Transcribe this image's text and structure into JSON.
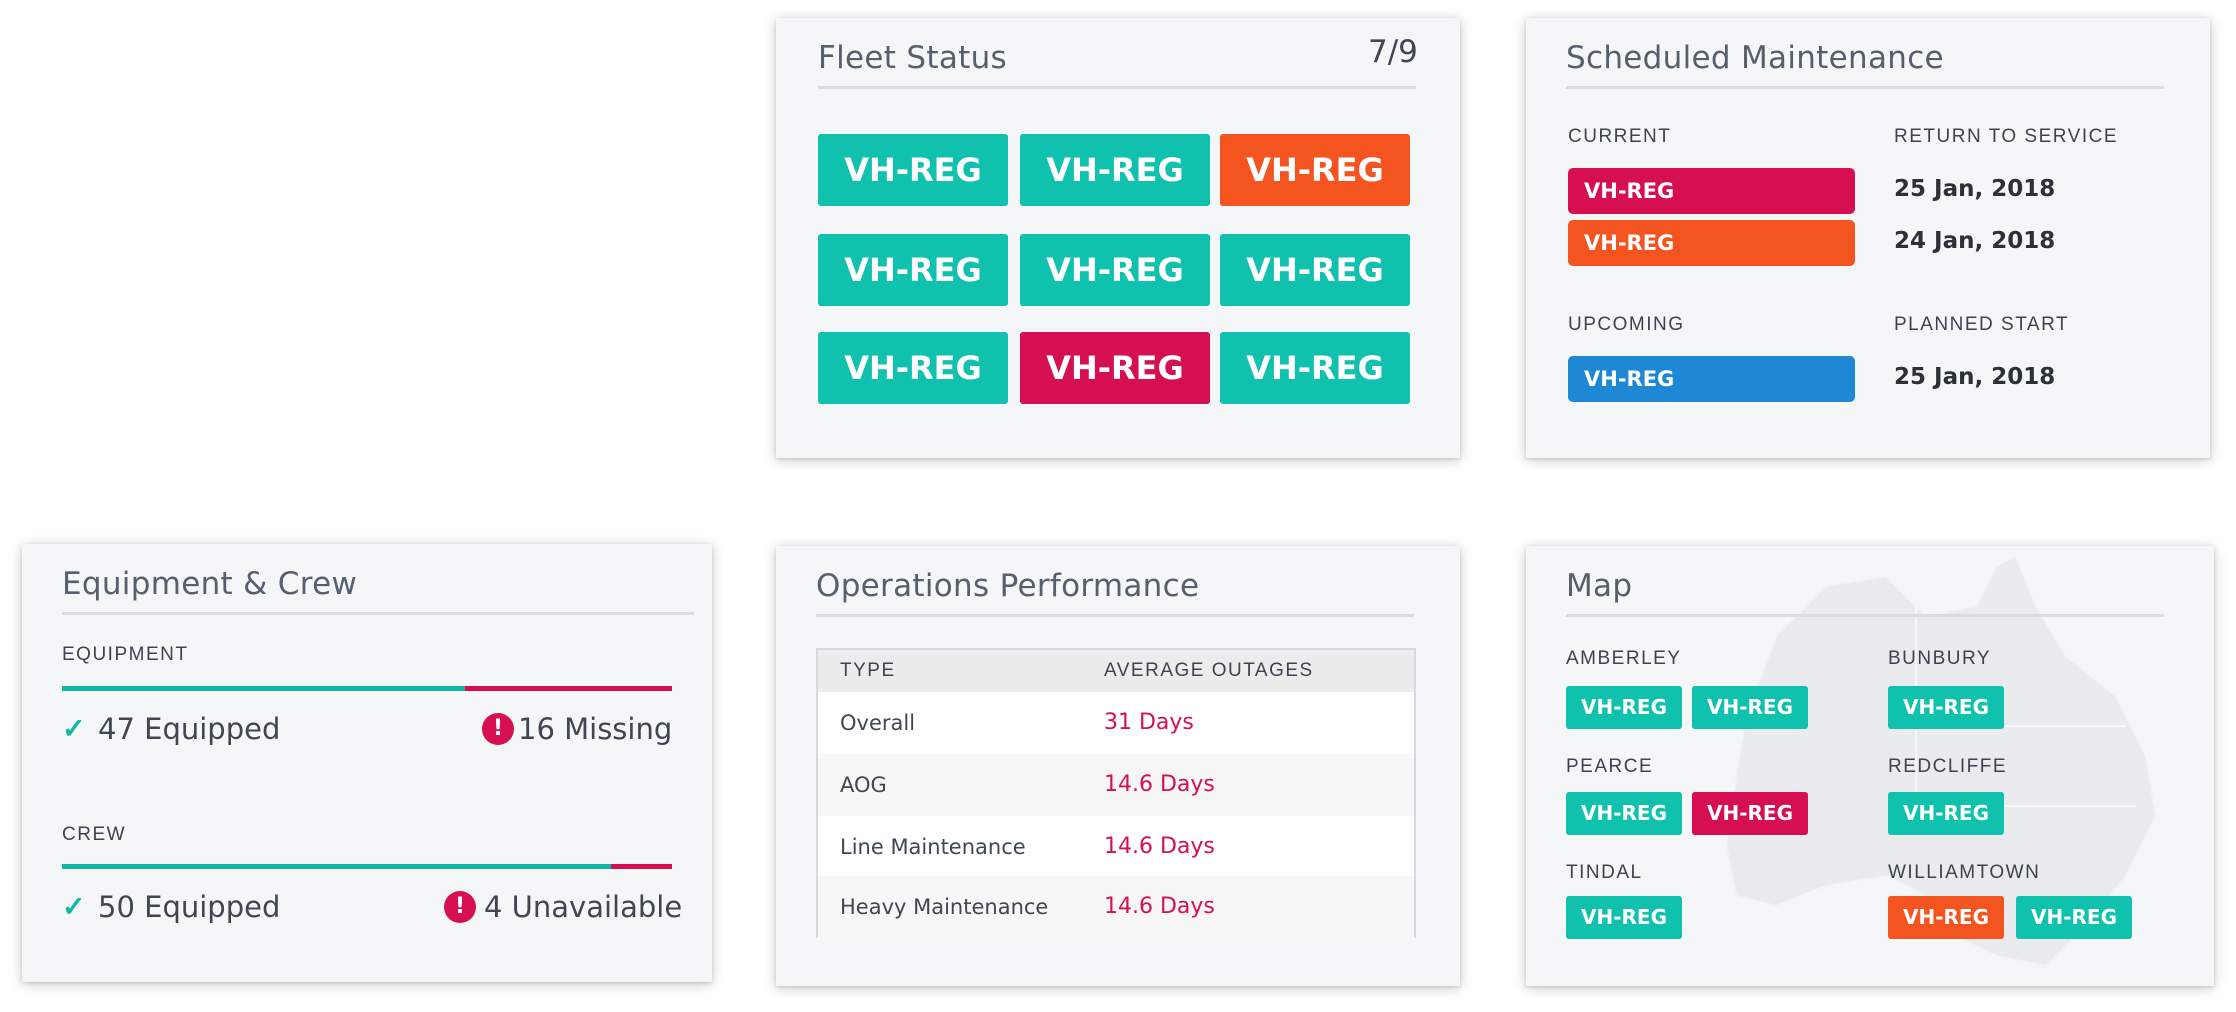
{
  "fleet_status": {
    "title": "Fleet Status",
    "count": "7/9",
    "tiles": [
      {
        "label": "VH-REG",
        "status": "teal"
      },
      {
        "label": "VH-REG",
        "status": "teal"
      },
      {
        "label": "VH-REG",
        "status": "orange"
      },
      {
        "label": "VH-REG",
        "status": "teal"
      },
      {
        "label": "VH-REG",
        "status": "teal"
      },
      {
        "label": "VH-REG",
        "status": "teal"
      },
      {
        "label": "VH-REG",
        "status": "teal"
      },
      {
        "label": "VH-REG",
        "status": "crimson"
      },
      {
        "label": "VH-REG",
        "status": "teal"
      }
    ]
  },
  "scheduled_maintenance": {
    "title": "Scheduled Maintenance",
    "current_label": "CURRENT",
    "return_label": "RETURN TO SERVICE",
    "current": [
      {
        "reg": "VH-REG",
        "date": "25 Jan, 2018",
        "status": "crimson"
      },
      {
        "reg": "VH-REG",
        "date": "24 Jan, 2018",
        "status": "orange"
      }
    ],
    "upcoming_label": "UPCOMING",
    "planned_label": "PLANNED START",
    "upcoming": [
      {
        "reg": "VH-REG",
        "date": "25 Jan, 2018",
        "status": "blue"
      }
    ]
  },
  "equipment_crew": {
    "title": "Equipment & Crew",
    "equipment": {
      "label": "EQUIPMENT",
      "equipped_text": "47 Equipped",
      "missing_text": "16 Missing",
      "equipped_fraction": 0.66
    },
    "crew": {
      "label": "CREW",
      "equipped_text": "50 Equipped",
      "unavailable_text": "4 Unavailable",
      "equipped_fraction": 0.9
    }
  },
  "operations_performance": {
    "title": "Operations Performance",
    "columns": [
      "TYPE",
      "AVERAGE OUTAGES"
    ],
    "rows": [
      {
        "type": "Overall",
        "value": "31 Days"
      },
      {
        "type": "AOG",
        "value": "14.6 Days"
      },
      {
        "type": "Line Maintenance",
        "value": "14.6 Days"
      },
      {
        "type": "Heavy Maintenance",
        "value": "14.6 Days"
      }
    ]
  },
  "map": {
    "title": "Map",
    "locations": [
      {
        "name": "AMBERLEY",
        "tiles": [
          {
            "label": "VH-REG",
            "status": "teal"
          },
          {
            "label": "VH-REG",
            "status": "teal"
          }
        ]
      },
      {
        "name": "BUNBURY",
        "tiles": [
          {
            "label": "VH-REG",
            "status": "teal"
          }
        ]
      },
      {
        "name": "PEARCE",
        "tiles": [
          {
            "label": "VH-REG",
            "status": "teal"
          },
          {
            "label": "VH-REG",
            "status": "crimson"
          }
        ]
      },
      {
        "name": "REDCLIFFE",
        "tiles": [
          {
            "label": "VH-REG",
            "status": "teal"
          }
        ]
      },
      {
        "name": "TINDAL",
        "tiles": [
          {
            "label": "VH-REG",
            "status": "teal"
          }
        ]
      },
      {
        "name": "WILLIAMTOWN",
        "tiles": [
          {
            "label": "VH-REG",
            "status": "orange"
          },
          {
            "label": "VH-REG",
            "status": "teal"
          }
        ]
      }
    ]
  },
  "colors": {
    "teal": "#10c2ad",
    "orange": "#f35420",
    "crimson": "#d50f51",
    "blue": "#1e88d4"
  }
}
